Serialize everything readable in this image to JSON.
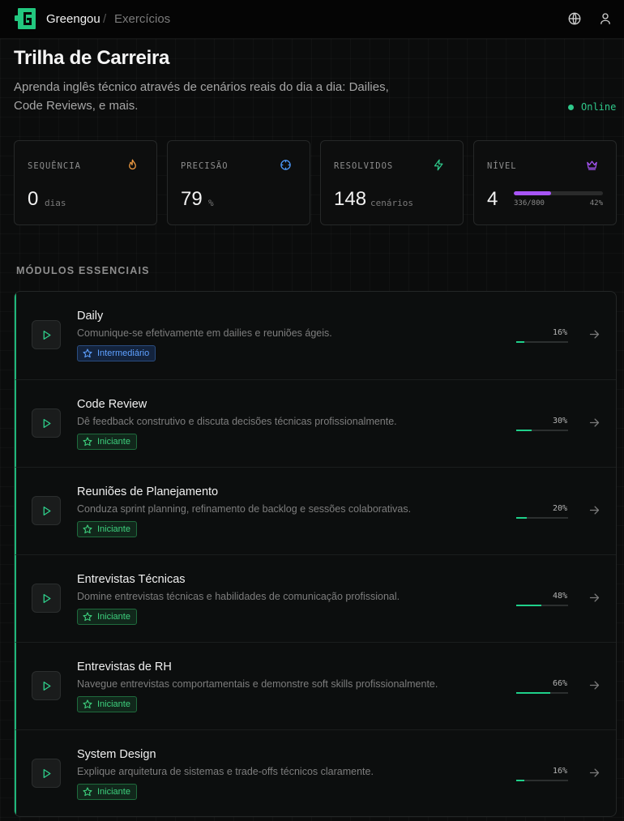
{
  "header": {
    "brand": "Greengou",
    "separator": "/",
    "breadcrumb": "Exercícios",
    "icons": [
      "globe-icon",
      "user-icon"
    ]
  },
  "page": {
    "title": "Trilha de Carreira",
    "subtitle": "Aprenda inglês técnico através de cenários reais do dia a dia: Dailies, Code Reviews, e mais.",
    "status": "Online"
  },
  "stats": {
    "streak": {
      "label": "SEQUÊNCIA",
      "value": "0",
      "unit": "dias",
      "icon": "flame-icon",
      "color": "#f59e42"
    },
    "accuracy": {
      "label": "PRECISÃO",
      "value": "79",
      "unit": "%",
      "icon": "crosshair-icon",
      "color": "#4d9bff"
    },
    "solved": {
      "label": "RESOLVIDOS",
      "value": "148",
      "unit": "cenários",
      "icon": "bolt-icon",
      "color": "#2fc98b"
    },
    "level": {
      "label": "NÍVEL",
      "value": "4",
      "xp": "336/800",
      "percent_label": "42%",
      "progress": 0.42,
      "icon": "crown-icon",
      "color": "#a855f7"
    }
  },
  "section": {
    "title": "MÓDULOS ESSENCIAIS"
  },
  "modules": [
    {
      "title": "Daily",
      "description": "Comunique-se efetivamente em dailies e reuniões ágeis.",
      "badge": "Intermediário",
      "badge_color": "blue",
      "percent": "16%",
      "progress": 0.16
    },
    {
      "title": "Code Review",
      "description": "Dê feedback construtivo e discuta decisões técnicas profissionalmente.",
      "badge": "Iniciante",
      "badge_color": "green",
      "percent": "30%",
      "progress": 0.3
    },
    {
      "title": "Reuniões de Planejamento",
      "description": "Conduza sprint planning, refinamento de backlog e sessões colaborativas.",
      "badge": "Iniciante",
      "badge_color": "green",
      "percent": "20%",
      "progress": 0.2
    },
    {
      "title": "Entrevistas Técnicas",
      "description": "Domine entrevistas técnicas e habilidades de comunicação profissional.",
      "badge": "Iniciante",
      "badge_color": "green",
      "percent": "48%",
      "progress": 0.48
    },
    {
      "title": "Entrevistas de RH",
      "description": "Navegue entrevistas comportamentais e demonstre soft skills profissionalmente.",
      "badge": "Iniciante",
      "badge_color": "green",
      "percent": "66%",
      "progress": 0.66
    },
    {
      "title": "System Design",
      "description": "Explique arquitetura de sistemas e trade-offs técnicos claramente.",
      "badge": "Iniciante",
      "badge_color": "green",
      "percent": "16%",
      "progress": 0.16
    }
  ]
}
